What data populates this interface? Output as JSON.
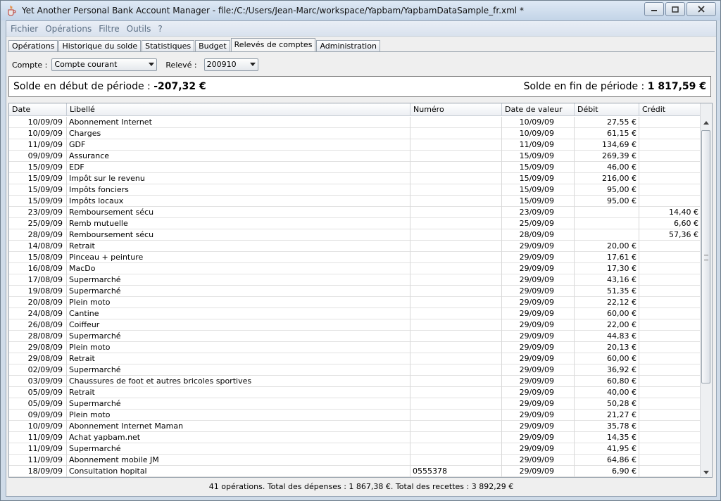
{
  "window": {
    "title": "Yet Another Personal Bank Account Manager - file:/C:/Users/Jean-Marc/workspace/Yapbam/YapbamDataSample_fr.xml *"
  },
  "menu": [
    "Fichier",
    "Opérations",
    "Filtre",
    "Outils",
    "?"
  ],
  "tabs": [
    {
      "label": "Opérations",
      "active": false
    },
    {
      "label": "Historique du solde",
      "active": false
    },
    {
      "label": "Statistiques",
      "active": false
    },
    {
      "label": "Budget",
      "active": false
    },
    {
      "label": "Relevés de comptes",
      "active": true
    },
    {
      "label": "Administration",
      "active": false
    }
  ],
  "filters": {
    "account_label": "Compte :",
    "account_value": "Compte courant",
    "statement_label": "Relevé :",
    "statement_value": "200910"
  },
  "balance": {
    "start_label": "Solde en début de période : ",
    "start_value": "-207,32 €",
    "end_label": "Solde en fin de période : ",
    "end_value": "1 817,59 €"
  },
  "table": {
    "columns": [
      "Date",
      "Libellé",
      "Numéro",
      "Date de valeur",
      "Débit",
      "Crédit"
    ],
    "rows": [
      [
        "10/09/09",
        "Abonnement Internet",
        "",
        "10/09/09",
        "27,55 €",
        ""
      ],
      [
        "10/09/09",
        "Charges",
        "",
        "10/09/09",
        "61,15 €",
        ""
      ],
      [
        "11/09/09",
        "GDF",
        "",
        "11/09/09",
        "134,69 €",
        ""
      ],
      [
        "09/09/09",
        "Assurance",
        "",
        "15/09/09",
        "269,39 €",
        ""
      ],
      [
        "15/09/09",
        "EDF",
        "",
        "15/09/09",
        "46,00 €",
        ""
      ],
      [
        "15/09/09",
        "Impôt sur le revenu",
        "",
        "15/09/09",
        "216,00 €",
        ""
      ],
      [
        "15/09/09",
        "Impôts fonciers",
        "",
        "15/09/09",
        "95,00 €",
        ""
      ],
      [
        "15/09/09",
        "Impôts locaux",
        "",
        "15/09/09",
        "95,00 €",
        ""
      ],
      [
        "23/09/09",
        "Remboursement sécu",
        "",
        "23/09/09",
        "",
        "14,40 €"
      ],
      [
        "25/09/09",
        "Remb mutuelle",
        "",
        "25/09/09",
        "",
        "6,60 €"
      ],
      [
        "28/09/09",
        "Remboursement sécu",
        "",
        "28/09/09",
        "",
        "57,36 €"
      ],
      [
        "14/08/09",
        "Retrait",
        "",
        "29/09/09",
        "20,00 €",
        ""
      ],
      [
        "15/08/09",
        "Pinceau + peinture",
        "",
        "29/09/09",
        "17,61 €",
        ""
      ],
      [
        "16/08/09",
        "MacDo",
        "",
        "29/09/09",
        "17,30 €",
        ""
      ],
      [
        "17/08/09",
        "Supermarché",
        "",
        "29/09/09",
        "43,16 €",
        ""
      ],
      [
        "19/08/09",
        "Supermarché",
        "",
        "29/09/09",
        "51,35 €",
        ""
      ],
      [
        "20/08/09",
        "Plein moto",
        "",
        "29/09/09",
        "22,12 €",
        ""
      ],
      [
        "24/08/09",
        "Cantine",
        "",
        "29/09/09",
        "60,00 €",
        ""
      ],
      [
        "26/08/09",
        "Coiffeur",
        "",
        "29/09/09",
        "22,00 €",
        ""
      ],
      [
        "28/08/09",
        "Supermarché",
        "",
        "29/09/09",
        "44,83 €",
        ""
      ],
      [
        "29/08/09",
        "Plein moto",
        "",
        "29/09/09",
        "20,13 €",
        ""
      ],
      [
        "29/08/09",
        "Retrait",
        "",
        "29/09/09",
        "60,00 €",
        ""
      ],
      [
        "02/09/09",
        "Supermarché",
        "",
        "29/09/09",
        "36,92 €",
        ""
      ],
      [
        "03/09/09",
        "Chaussures de foot et autres bricoles sportives",
        "",
        "29/09/09",
        "60,80 €",
        ""
      ],
      [
        "05/09/09",
        "Retrait",
        "",
        "29/09/09",
        "40,00 €",
        ""
      ],
      [
        "05/09/09",
        "Supermarché",
        "",
        "29/09/09",
        "50,28 €",
        ""
      ],
      [
        "09/09/09",
        "Plein moto",
        "",
        "29/09/09",
        "21,27 €",
        ""
      ],
      [
        "10/09/09",
        "Abonnement Internet Maman",
        "",
        "29/09/09",
        "35,78 €",
        ""
      ],
      [
        "11/09/09",
        "Achat yapbam.net",
        "",
        "29/09/09",
        "14,35 €",
        ""
      ],
      [
        "11/09/09",
        "Supermarché",
        "",
        "29/09/09",
        "41,95 €",
        ""
      ],
      [
        "11/09/09",
        "Abonnement mobile JM",
        "",
        "29/09/09",
        "64,86 €",
        ""
      ],
      [
        "18/09/09",
        "Consultation hopital",
        "0555378",
        "29/09/09",
        "6,90 €",
        ""
      ]
    ]
  },
  "summary": "41 opérations. Total des dépenses : 1 867,38 €. Total des recettes : 3 892,29 €",
  "icons": {
    "app": "java-cup-icon",
    "minimize": "minimize-icon",
    "maximize": "maximize-icon",
    "close": "close-icon"
  }
}
